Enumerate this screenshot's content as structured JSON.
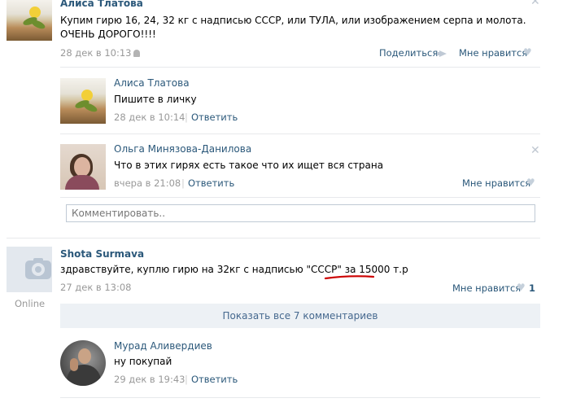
{
  "post1": {
    "author": "Алиса Тлатова",
    "text": "Купим гирю 16, 24, 32 кг с надписью СССР, или ТУЛА, или изображением серпа и молота. ОЧЕНЬ ДОРОГО!!!!",
    "date": "28 дек в 10:13",
    "share_label": "Поделиться",
    "like_label": "Мне нравится"
  },
  "comments1": [
    {
      "author": "Алиса Тлатова",
      "text": "Пишите в личку",
      "date": "28 дек в 10:14",
      "sep": "|",
      "reply_label": "Ответить"
    },
    {
      "author": "Ольга Минязова-Данилова",
      "text": "Что в этих гирях есть такое что их ищет вся страна",
      "date": "вчера в 21:08",
      "sep": "|",
      "reply_label": "Ответить",
      "like_label": "Мне нравится"
    }
  ],
  "comment_input": {
    "placeholder": "Комментировать.."
  },
  "post2": {
    "author": "Shota Surmava",
    "status": "Online",
    "text_before": "здравствуйте, куплю гирю на 32кг с надписью \"СССР\" за ",
    "price": "15000",
    "text_after": " т.р",
    "date": "27 дек в 13:08",
    "like_label": "Мне нравится",
    "like_count": "1",
    "show_all_label": "Показать все 7 комментариев"
  },
  "comments2": [
    {
      "author": "Мурад Аливердиев",
      "text": "ну покупай",
      "date": "29 дек в 19:43",
      "sep": "|",
      "reply_label": "Ответить"
    }
  ],
  "icons": {
    "close": "✕",
    "heart": "♥"
  },
  "colors": {
    "link": "#2b587a",
    "muted": "#999999",
    "underline": "#cc0000"
  }
}
